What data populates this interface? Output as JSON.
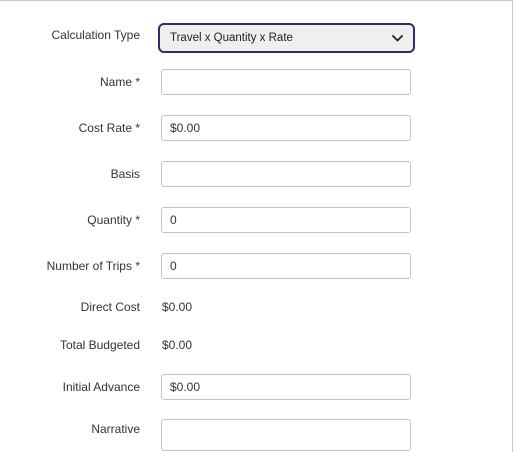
{
  "form": {
    "calculation_type": {
      "label": "Calculation Type",
      "value": "Travel x Quantity x Rate",
      "icon": "chevron-down-icon"
    },
    "name": {
      "label": "Name *",
      "value": "",
      "placeholder": ""
    },
    "cost_rate": {
      "label": "Cost Rate *",
      "value": "$0.00"
    },
    "basis": {
      "label": "Basis",
      "value": ""
    },
    "quantity": {
      "label": "Quantity *",
      "value": "0"
    },
    "number_of_trips": {
      "label": "Number of Trips *",
      "value": "0"
    },
    "direct_cost": {
      "label": "Direct Cost",
      "value": "$0.00"
    },
    "total_budgeted": {
      "label": "Total Budgeted",
      "value": "$0.00"
    },
    "initial_advance": {
      "label": "Initial Advance",
      "value": "$0.00"
    },
    "narrative": {
      "label": "Narrative",
      "value": ""
    }
  },
  "colors": {
    "focus_border": "#2c2f66",
    "input_border": "#c4c4c4",
    "select_background": "#efefef"
  }
}
